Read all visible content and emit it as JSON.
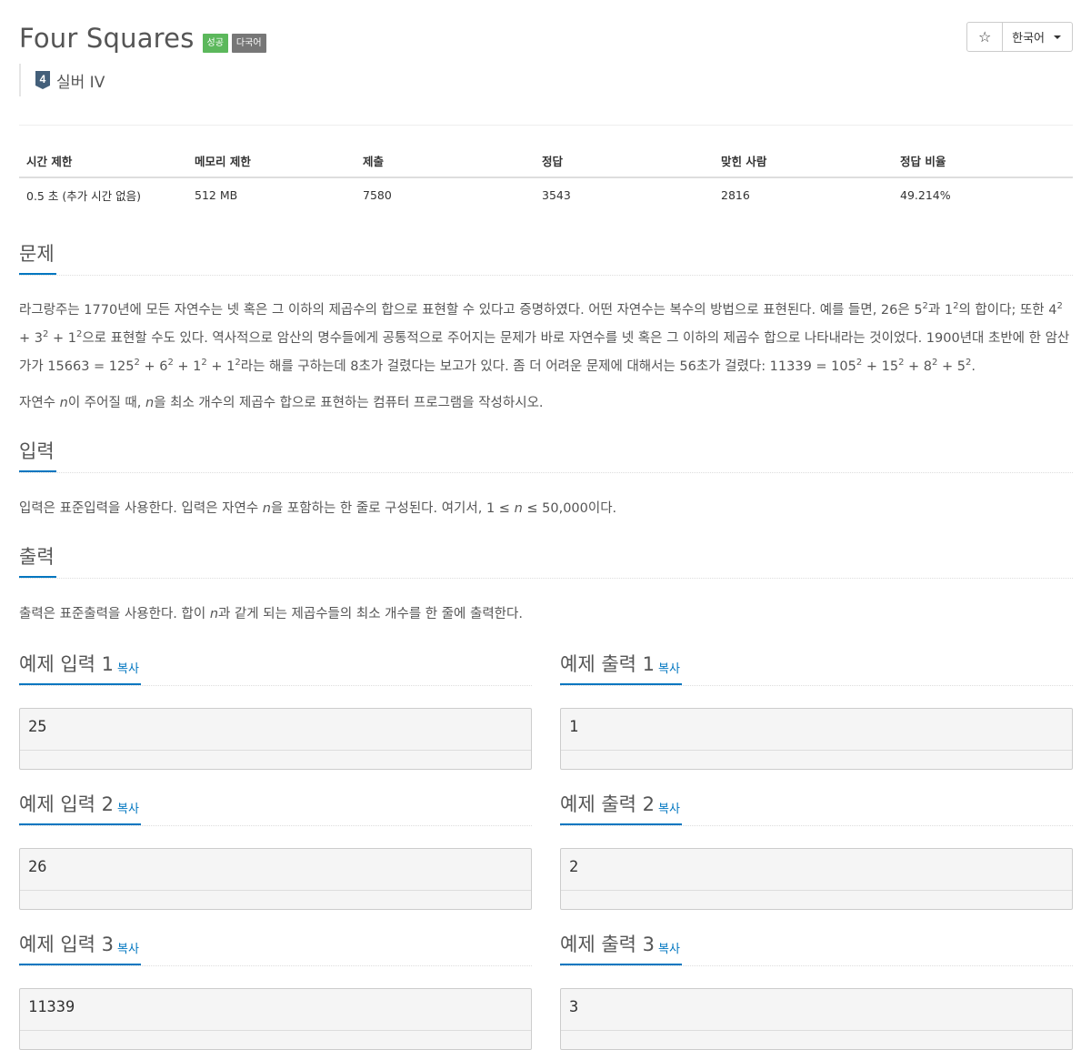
{
  "problem": {
    "title": "Four Squares",
    "badges": {
      "success": "성공",
      "multi": "다국어"
    },
    "tier": {
      "number": "4",
      "label": "실버 IV",
      "color": "#435f7a"
    }
  },
  "actions": {
    "star": "☆",
    "language": "한국어"
  },
  "stats": {
    "headers": [
      "시간 제한",
      "메모리 제한",
      "제출",
      "정답",
      "맞힌 사람",
      "정답 비율"
    ],
    "values": [
      "0.5 초 (추가 시간 없음)",
      "512 MB",
      "7580",
      "3543",
      "2816",
      "49.214%"
    ]
  },
  "sections": {
    "problem": {
      "heading": "문제",
      "p1": {
        "a": "라그랑주는 1770년에 모든 자연수는 넷 혹은 그 이하의 제곱수의 합으로 표현할 수 있다고 증명하였다. 어떤 자연수는 복수의 방법으로 표현된다. 예를 들면, 26은 5",
        "b": "과 1",
        "c": "의 합이다; 또한 4",
        "d": " + 3",
        "e": " + 1",
        "f": "으로 표현할 수도 있다. 역사적으로 암산의 명수들에게 공통적으로 주어지는 문제가 바로 자연수를 넷 혹은 그 이하의 제곱수 합으로 나타내라는 것이었다. 1900년대 초반에 한 암산가가 15663 = 125",
        "g": " + 6",
        "h": " + 1",
        "i": " + 1",
        "j": "라는 해를 구하는데 8초가 걸렸다는 보고가 있다. 좀 더 어려운 문제에 대해서는 56초가 걸렸다: 11339 = 105",
        "k": " + 15",
        "l": " + 8",
        "m": " + 5",
        "n": ".",
        "exp": "2"
      },
      "p2": {
        "a": "자연수 ",
        "n": "n",
        "b": "이 주어질 때, ",
        "c": "을 최소 개수의 제곱수 합으로 표현하는 컴퓨터 프로그램을 작성하시오."
      }
    },
    "input": {
      "heading": "입력",
      "a": "입력은 표준입력을 사용한다. 입력은 자연수 ",
      "n": "n",
      "b": "을 포함하는 한 줄로 구성된다. 여기서, 1 ≤ ",
      "c": " ≤ 50,000이다."
    },
    "output": {
      "heading": "출력",
      "a": "출력은 표준출력을 사용한다. 합이 ",
      "n": "n",
      "b": "과 같게 되는 제곱수들의 최소 개수를 한 줄에 출력한다."
    }
  },
  "samples": {
    "copy_label": "복사",
    "items": [
      {
        "input_title": "예제 입력 1",
        "output_title": "예제 출력 1",
        "input": "25",
        "output": "1"
      },
      {
        "input_title": "예제 입력 2",
        "output_title": "예제 출력 2",
        "input": "26",
        "output": "2"
      },
      {
        "input_title": "예제 입력 3",
        "output_title": "예제 출력 3",
        "input": "11339",
        "output": "3"
      }
    ]
  }
}
